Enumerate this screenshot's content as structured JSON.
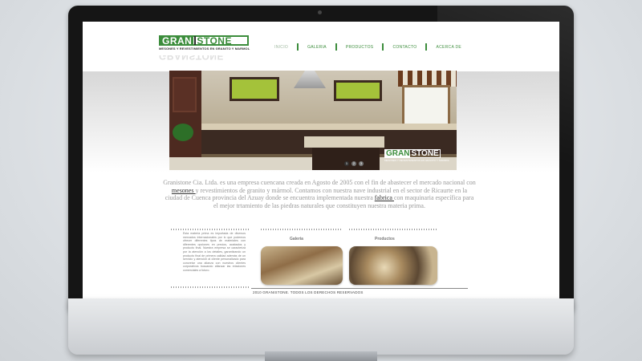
{
  "logo": {
    "part1": "GRAN",
    "part2": "STONE",
    "tagline": "MESONES Y REVESTIMIENTOS EN GRANITO Y MARMOL"
  },
  "nav": {
    "items": [
      "INICIO",
      "GALERIA",
      "PRODUCTOS",
      "CONTACTO",
      "ACERCA DE"
    ],
    "active_index": 0
  },
  "hero": {
    "watermark_part1": "GRAN",
    "watermark_part2": "STONE",
    "slider_pages": [
      "1",
      "2",
      "3"
    ],
    "active_page": 1
  },
  "intro": {
    "t1": "Granistone Cia. Ltda. es una empresa cuencana creada en Agosto de 2005 con el fin de abastecer el mercado nacional con ",
    "link1": "mesones ",
    "t2": "y revestimientos de granito y mármol. Contamos con nuestra nave industrial en el sector de Ricaurte en la ciudad de Cuenca provincia del Azuay donde se encuentra implementada nuestra ",
    "link2": "fabrica ",
    "t3": "con maquinaria específica para el mejor trtamiento de las piedras naturales que constituyen nuestra materia prima."
  },
  "columns": {
    "text": "Esta materia prima es importada de diversos mercados internacionales por lo que podemos ofrecer diferentes tipos de materiales con diferentes opciones en precios, acabados y producto final. Nuestra empresa se caracteriza por la atención a los detalles, garantizando un producto final de primera calidad además de un servicio y atención al cliente personalizado para concretar una alianza con nuestros clientes corporativos buscando afianzar las relaciones comerciales a futuro.",
    "galeria_label": "Galeria",
    "productos_label": "Productos"
  },
  "footer": {
    "text": "2010 GRANISTONE. TODOS LOS DERECHOS RESERVADOS"
  },
  "colors": {
    "brand_green": "#3c8d3c",
    "monitor_bezel": "#151515"
  }
}
